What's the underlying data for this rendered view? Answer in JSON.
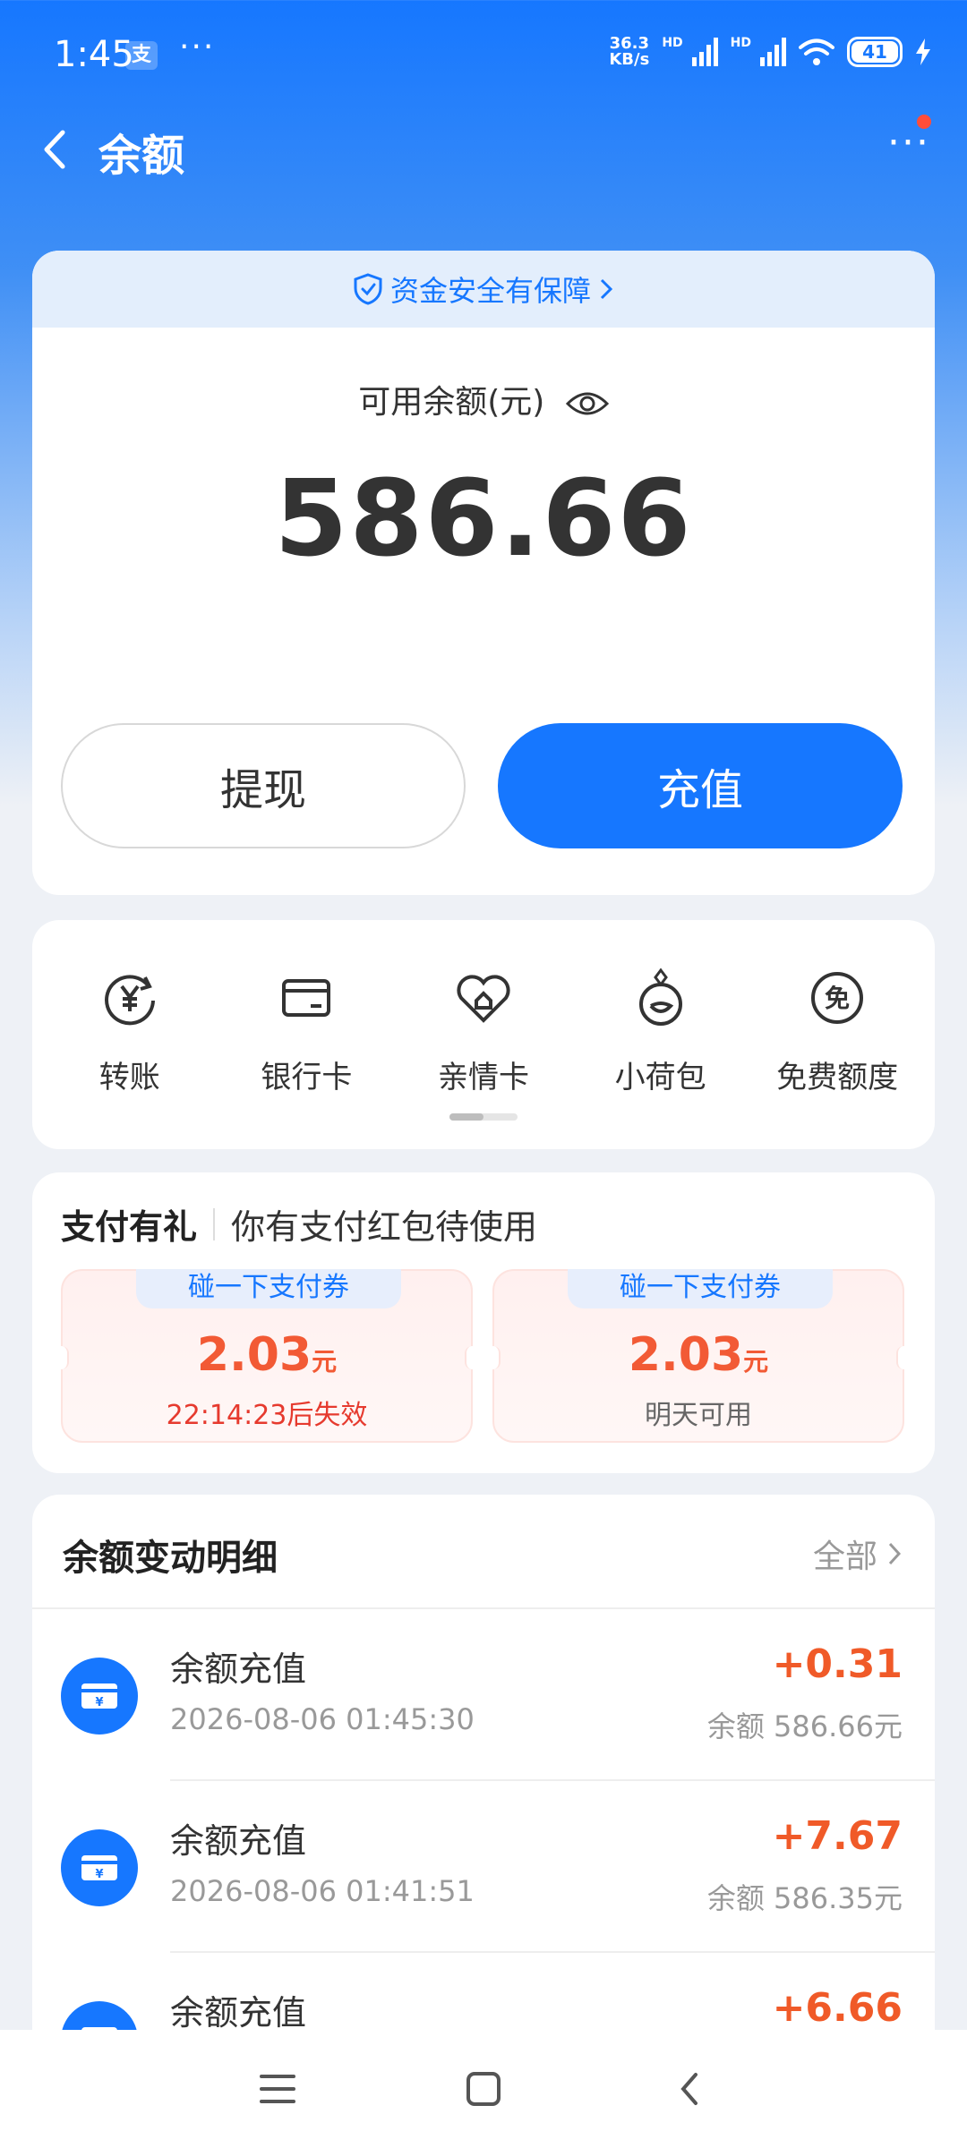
{
  "status_bar": {
    "time": "1:45",
    "app_badge": "支",
    "dots": "···",
    "net_speed_top": "36.3",
    "net_speed_bottom": "KB/s",
    "hd1": "HD",
    "hd2": "HD",
    "battery": "41"
  },
  "nav": {
    "title": "余额",
    "more": "···"
  },
  "balance": {
    "safety_text": "资金安全有保障",
    "label": "可用余额(元)",
    "amount": "586.66",
    "withdraw_label": "提现",
    "recharge_label": "充值"
  },
  "functions": [
    {
      "label": "转账",
      "icon": "transfer-yen-icon"
    },
    {
      "label": "银行卡",
      "icon": "bank-card-icon"
    },
    {
      "label": "亲情卡",
      "icon": "family-card-icon"
    },
    {
      "label": "小荷包",
      "icon": "pouch-icon"
    },
    {
      "label": "免费额度",
      "icon": "free-quota-icon"
    }
  ],
  "coupons": {
    "title": "支付有礼",
    "subtitle": "你有支付红包待使用",
    "items": [
      {
        "tag": "碰一下支付券",
        "amount": "2.03",
        "unit": "元",
        "note": "22:14:23后失效",
        "note_color": "#e63a2e"
      },
      {
        "tag": "碰一下支付券",
        "amount": "2.03",
        "unit": "元",
        "note": "明天可用",
        "note_color": "#666666"
      }
    ]
  },
  "transactions": {
    "title": "余额变动明细",
    "all_label": "全部",
    "rows": [
      {
        "name": "余额充值",
        "date": "2026-08-06 01:45:30",
        "amount": "+0.31",
        "balance": "余额 586.66元"
      },
      {
        "name": "余额充值",
        "date": "2026-08-06 01:41:51",
        "amount": "+7.67",
        "balance": "余额 586.35元"
      },
      {
        "name": "余额充值",
        "date": "",
        "amount": "+6.66",
        "balance": ""
      }
    ]
  },
  "colors": {
    "brand": "#1677ff",
    "amount_orange": "#f05a28"
  }
}
